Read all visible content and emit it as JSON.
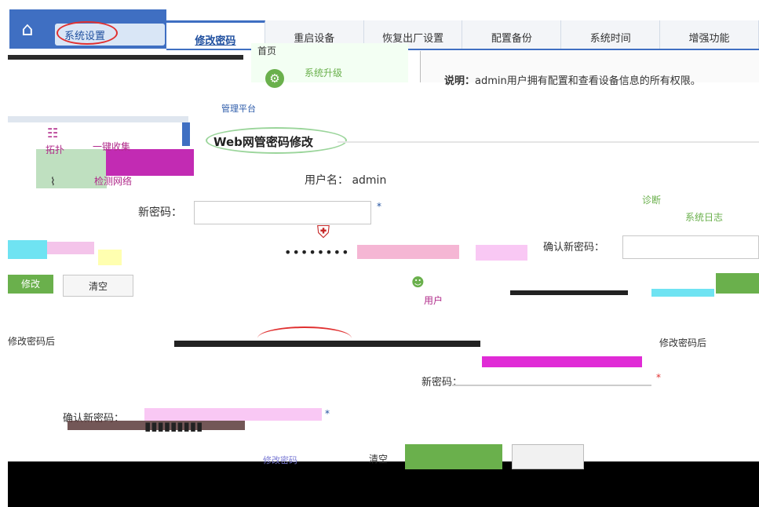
{
  "topbar": {
    "home_icon": "⌂",
    "system_settings": "系统设置",
    "tabs": [
      "修改密码",
      "重启设备",
      "恢复出厂设置",
      "配置备份",
      "系统时间",
      "增强功能"
    ]
  },
  "system": {
    "home_label": "首页",
    "upgrade_label": "系统升级",
    "management_label": "管理平台",
    "notice_label": "说明：",
    "notice_text": "admin用户拥有配置和查看设备信息的所有权限。"
  },
  "sidebar": {
    "topology_label": "拓扑",
    "collect_label": "一键收集",
    "monitor_label": "检测网络"
  },
  "form1": {
    "title": "Web网管密码修改",
    "username_label": "用户名：",
    "username_value": "admin",
    "new_password_label": "新密码：",
    "new_password_value": "",
    "confirm_label": "确认新密码：",
    "confirm_value": "",
    "required": "*",
    "save_label": "修改",
    "clear_label": "清空",
    "masked_password": "••••••••",
    "user_label": "用户"
  },
  "right_links": {
    "diagnose": "诊断",
    "syslog": "系统日志",
    "security": "安全"
  },
  "form2": {
    "left_text": "修改密码后",
    "right_text": "修改密码后",
    "pw_label": "新密码：",
    "confirm_label": "确认新密码：",
    "masked_password": "▮▮▮▮▮▮▮▮▮",
    "required": "*",
    "clear_label": "清空",
    "link_text": "修改密码"
  }
}
